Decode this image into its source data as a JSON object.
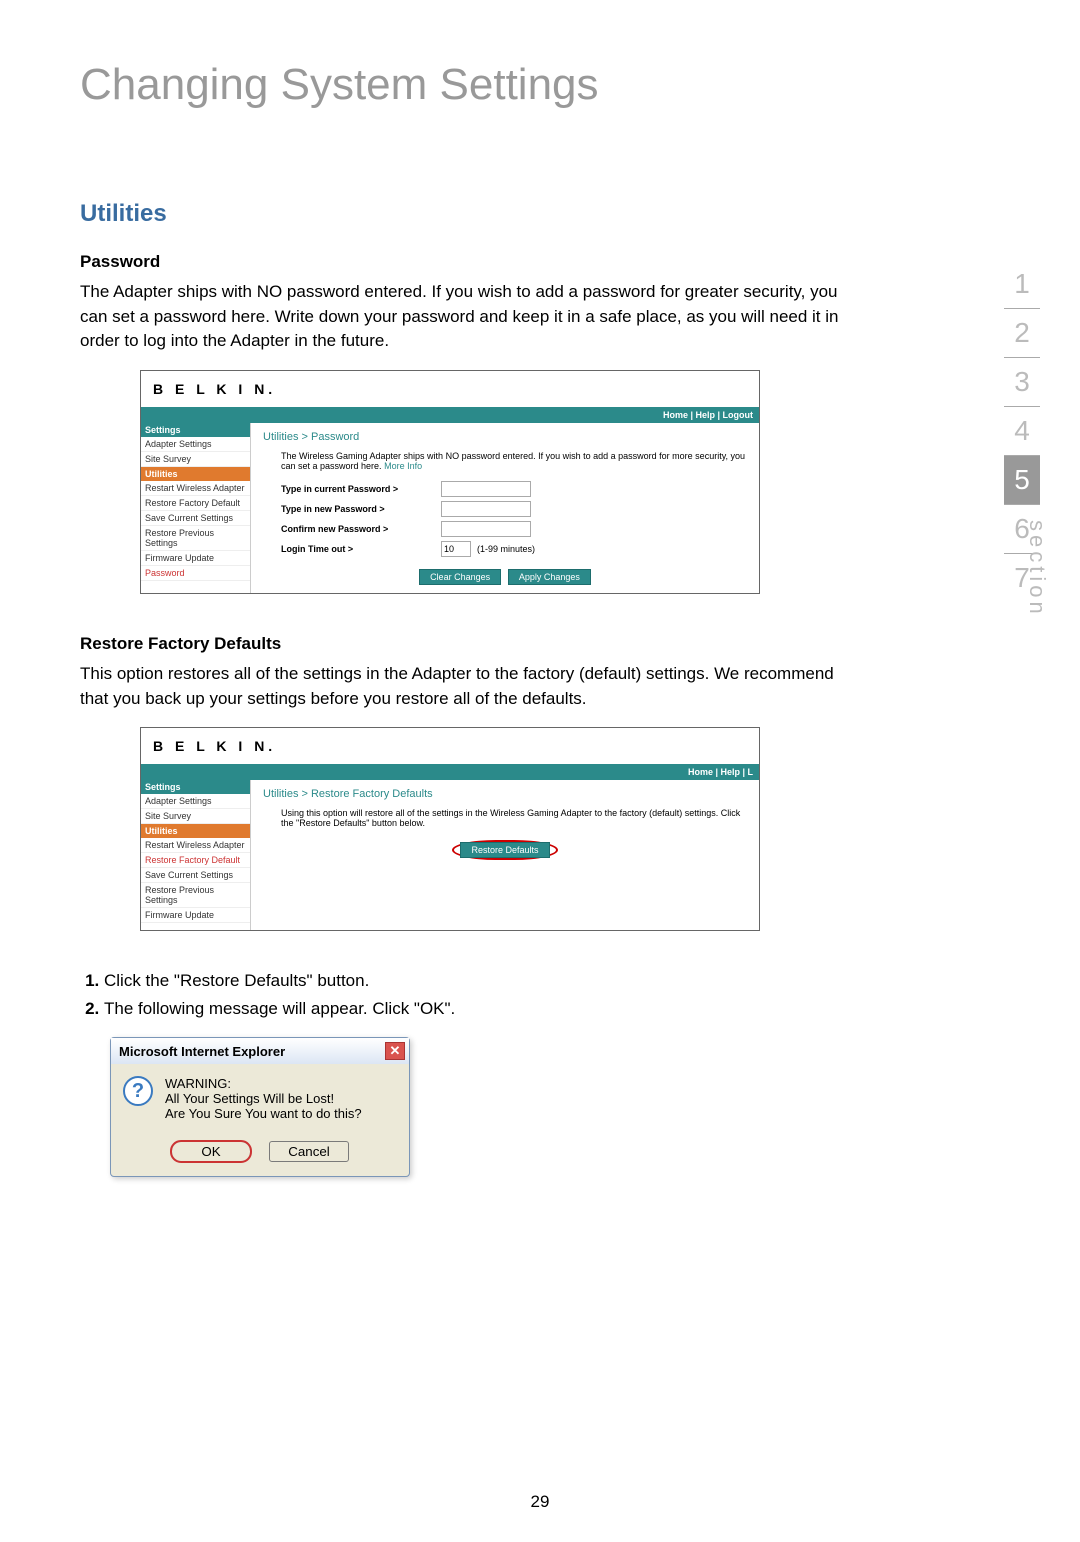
{
  "pageTitle": "Changing System Settings",
  "sectionLabel": "section",
  "tabs": [
    "1",
    "2",
    "3",
    "4",
    "5",
    "6",
    "7"
  ],
  "activeTab": "5",
  "utilitiesHeading": "Utilities",
  "password": {
    "heading": "Password",
    "body": "The Adapter ships with NO password entered. If you wish to add a password for greater security, you can set a password here. Write down your password and keep it in a safe place, as you will need it in order to log into the Adapter in the future."
  },
  "shot1": {
    "logo": "B E L K I N.",
    "topLinks": "Home | Help | Logout",
    "crumb": "Utilities > Password",
    "desc": "The Wireless Gaming Adapter ships with NO password entered. If you wish to add a password for more security, you can set a password here.",
    "moreInfo": "More Info",
    "sidebar": {
      "settings": "Settings",
      "items1": [
        "Adapter Settings",
        "Site Survey"
      ],
      "utilities": "Utilities",
      "items2": [
        "Restart Wireless Adapter",
        "Restore Factory Default",
        "Save Current Settings",
        "Restore Previous Settings",
        "Firmware Update",
        "Password"
      ]
    },
    "fields": {
      "current": "Type in current Password >",
      "new": "Type in new Password >",
      "confirm": "Confirm new Password >",
      "timeout": "Login Time out >",
      "timeoutValue": "10",
      "timeoutHint": "(1-99 minutes)"
    },
    "buttons": {
      "clear": "Clear Changes",
      "apply": "Apply Changes"
    }
  },
  "restore": {
    "heading": "Restore Factory Defaults",
    "body": "This option restores all of the settings in the Adapter to the factory (default) settings. We recommend that you back up your settings before you restore all of the defaults."
  },
  "shot2": {
    "logo": "B E L K I N.",
    "topLinks": "Home | Help | L",
    "crumb": "Utilities > Restore Factory Defaults",
    "desc": "Using this option will restore all of the settings in the Wireless Gaming Adapter to the factory (default) settings. Click the \"Restore Defaults\" button below.",
    "sidebar": {
      "settings": "Settings",
      "items1": [
        "Adapter Settings",
        "Site Survey"
      ],
      "utilities": "Utilities",
      "items2": [
        "Restart Wireless Adapter",
        "Restore Factory Default",
        "Save Current Settings",
        "Restore Previous Settings",
        "Firmware Update"
      ]
    },
    "button": "Restore Defaults"
  },
  "steps": [
    "Click the \"Restore Defaults\" button.",
    "The following message will appear. Click \"OK\"."
  ],
  "dialog": {
    "title": "Microsoft Internet Explorer",
    "line1": "WARNING:",
    "line2": "All Your Settings Will be Lost!",
    "line3": "Are You Sure You want to do this?",
    "ok": "OK",
    "cancel": "Cancel"
  },
  "pageNumber": "29"
}
